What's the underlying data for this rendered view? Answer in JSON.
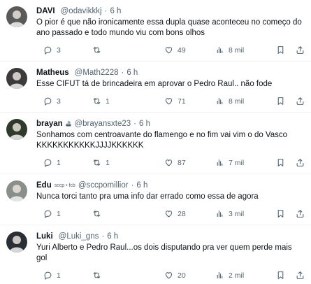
{
  "tweets": [
    {
      "name": "DAVI",
      "name_deco": "",
      "handle": "@odavikkkj",
      "time": "6 h",
      "text": "O pior é que não ironicamente essa dupla quase aconteceu no começo do ano passado e todo mundo viu com bons olhos",
      "replies": "3",
      "retweets": "",
      "likes": "49",
      "views": "8 mil",
      "avatar_color": "#5a5a5a"
    },
    {
      "name": "Matheus",
      "name_deco": "",
      "handle": "@Math2228",
      "time": "6 h",
      "text": "Esse CIFUT tá de brincadeira em aprovar o Pedro Raul.. não fode",
      "replies": "3",
      "retweets": "1",
      "likes": "71",
      "views": "8 mil",
      "avatar_color": "#3b3b3b"
    },
    {
      "name": "brayan",
      "name_deco": "🚢",
      "handle": "@brayansxte23",
      "time": "6 h",
      "text": "Sonhamos com centroavante do flamengo e no fim vai vim o do Vasco KKKKKKKKKKKJJJJKKKKKK",
      "replies": "1",
      "retweets": "1",
      "likes": "87",
      "views": "7 mil",
      "avatar_color": "#2f3a2a"
    },
    {
      "name": "Edu",
      "name_deco": "sccp • fcb",
      "handle": "@sccpomillior",
      "time": "6 h",
      "text": "Nunca torci tanto pra uma info dar errado como essa de agora",
      "replies": "1",
      "retweets": "",
      "likes": "28",
      "views": "3 mil",
      "avatar_color": "#8a8f8c"
    },
    {
      "name": "Luki",
      "name_deco": "",
      "handle": "@Luki_gns",
      "time": "6 h",
      "text": "Yuri Alberto e Pedro Raul...os dois disputando pra ver quem perde mais gol",
      "replies": "1",
      "retweets": "",
      "likes": "20",
      "views": "2 mil",
      "avatar_color": "#2a2f36"
    }
  ]
}
